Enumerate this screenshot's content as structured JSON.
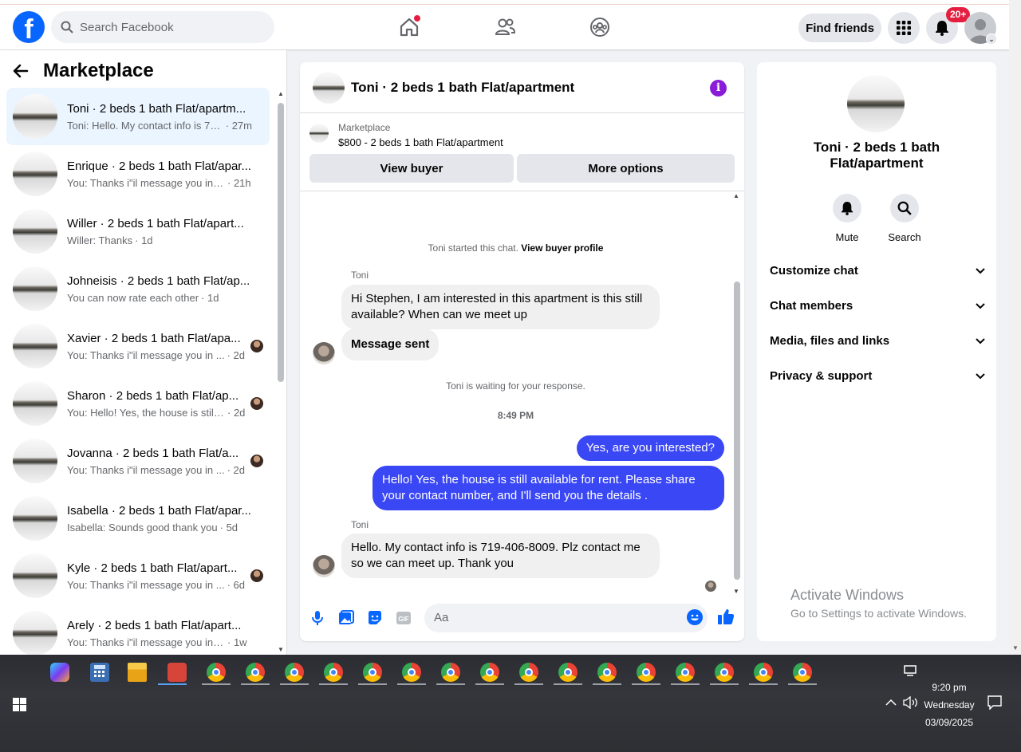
{
  "topbar": {
    "search_placeholder": "Search Facebook",
    "find_friends": "Find friends",
    "notif_badge": "20+"
  },
  "left": {
    "title": "Marketplace",
    "conversations": [
      {
        "title": "Toni · 2 beds 1 bath Flat/apartm...",
        "snippet": "Toni: Hello. My contact info is 719...",
        "time": "· 27m"
      },
      {
        "title": "Enrique · 2 beds 1 bath Flat/apar...",
        "snippet": "You: Thanks i\"il message you in a ...",
        "time": "· 21h"
      },
      {
        "title": "Willer · 2 beds 1 bath Flat/apart...",
        "snippet": "Willer: Thanks",
        "time": "· 1d"
      },
      {
        "title": "Johneisis · 2 beds 1 bath Flat/ap...",
        "snippet": "You can now rate each other",
        "time": "· 1d"
      },
      {
        "title": "Xavier · 2 beds 1 bath Flat/apa...",
        "snippet": "You: Thanks i\"il message you in ...",
        "time": "· 2d"
      },
      {
        "title": "Sharon · 2 beds 1 bath Flat/ap...",
        "snippet": "You: Hello! Yes, the house is still ...",
        "time": "· 2d"
      },
      {
        "title": "Jovanna · 2 beds 1 bath Flat/a...",
        "snippet": "You: Thanks i\"il message you in ...",
        "time": "· 2d"
      },
      {
        "title": "Isabella · 2 beds 1 bath Flat/apar...",
        "snippet": "Isabella: Sounds good thank you",
        "time": "· 5d"
      },
      {
        "title": "Kyle · 2 beds 1 bath Flat/apart...",
        "snippet": "You: Thanks i\"il message you in ...",
        "time": "· 6d"
      },
      {
        "title": "Arely · 2 beds 1 bath Flat/apart...",
        "snippet": "You: Thanks i\"il message you in a ...",
        "time": "· 1w"
      }
    ]
  },
  "chat": {
    "title": "Toni · 2 beds 1 bath Flat/apartment",
    "listing_label": "Marketplace",
    "listing_price": "$800 - 2 beds 1 bath Flat/apartment",
    "view_buyer": "View buyer",
    "more_options": "More options",
    "started": "Toni started this chat.",
    "view_profile": "View buyer profile",
    "sender": "Toni",
    "msg1": "Hi Stephen, I am interested in this apartment is this still available? When can we meet up",
    "msg2": "Message sent",
    "waiting": "Toni is waiting for your response.",
    "time": "8:49 PM",
    "out1": "Yes, are you interested?",
    "out2": "Hello! Yes, the house is still available for rent. Please share your contact number, and I'll send you the details .",
    "msg3": "Hello. My contact info is 719-406-8009. Plz contact me so we can meet up. Thank you",
    "composer_placeholder": "Aa"
  },
  "panel": {
    "title": "Toni · 2 beds 1 bath Flat/apartment",
    "mute": "Mute",
    "search": "Search",
    "sections": [
      "Customize chat",
      "Chat members",
      "Media, files and links",
      "Privacy & support"
    ]
  },
  "watermark": {
    "line1": "Activate Windows",
    "line2": "Go to Settings to activate Windows."
  },
  "taskbar": {
    "time": "9:20 pm",
    "day": "Wednesday",
    "date": "03/09/2025"
  }
}
